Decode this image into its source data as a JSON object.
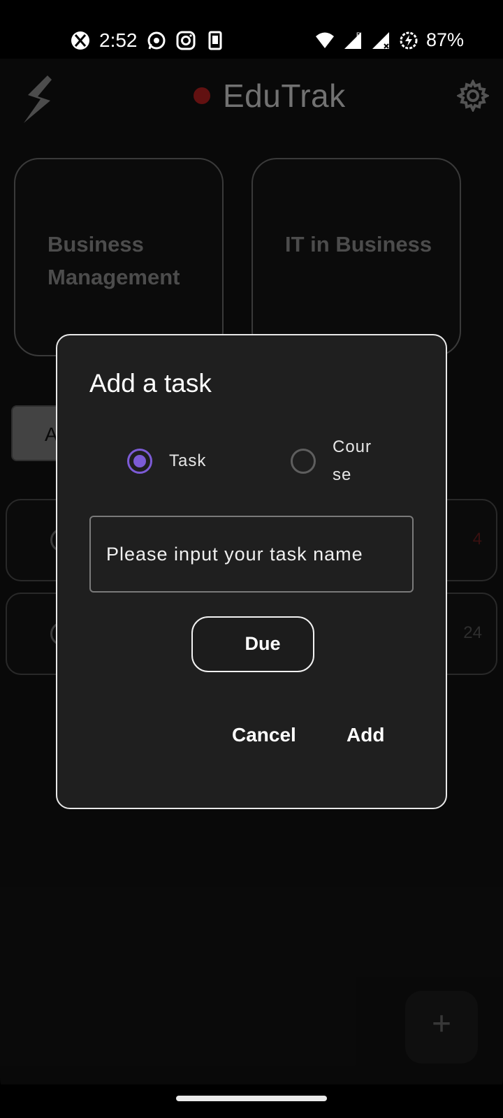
{
  "status_bar": {
    "time": "2:52",
    "battery": "87%",
    "left_icons": [
      "xbox-icon",
      "whatsapp-icon",
      "instagram-icon",
      "kindle-icon"
    ],
    "right_icons": [
      "wifi-icon",
      "signal-roaming-icon",
      "signal-icon",
      "battery-saver-icon"
    ]
  },
  "header": {
    "app_title": "EduTrak",
    "status_dot_color": "#b32020"
  },
  "courses": [
    {
      "name": "Business Management"
    },
    {
      "name": "IT in Business"
    }
  ],
  "filter": {
    "label": "A"
  },
  "task_rows": [
    {
      "date_fragment": "4"
    },
    {
      "date_fragment": "24"
    }
  ],
  "fab": {
    "label": "+"
  },
  "dialog": {
    "title": "Add a task",
    "radio_options": [
      {
        "label": "Task",
        "selected": true
      },
      {
        "label": "Cour\nse",
        "selected": false
      }
    ],
    "input_placeholder": "Please input your task name",
    "due_label": "Due",
    "cancel_label": "Cancel",
    "add_label": "Add"
  },
  "colors": {
    "accent": "#7c5bd6",
    "background": "#121212",
    "dialog_bg": "#1f1f1f"
  }
}
